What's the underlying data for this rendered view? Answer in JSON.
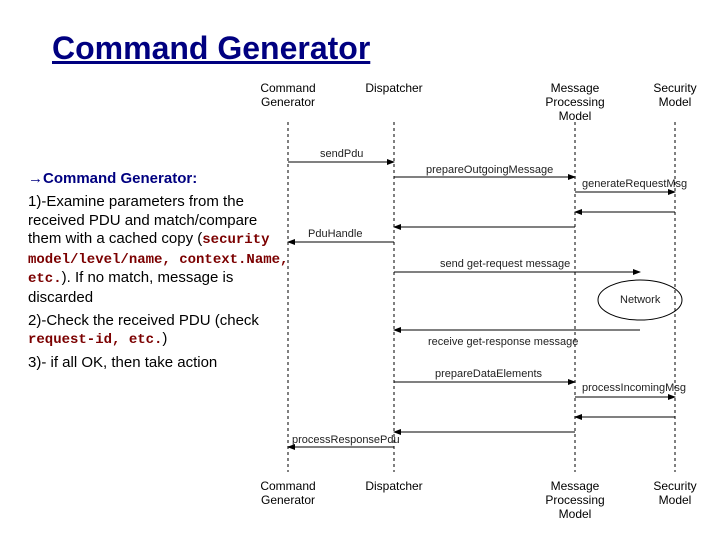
{
  "title": "Command Generator",
  "text": {
    "subheading_arrow": "→",
    "subheading": "Command Generator:",
    "item1_lead": "1)-Examine parameters from the received PDU and match/compare them with a cached copy (",
    "item1_code": "security model/level/name, context.Name, etc.",
    "item1_tail": "). If no match, message is discarded",
    "item2_lead": "2)-Check the received PDU (check ",
    "item2_code": "request-id, etc.",
    "item2_tail": ")",
    "item3": "3)- if all OK, then take action"
  },
  "diagram": {
    "headers_top": [
      "Command\nGenerator",
      "Dispatcher",
      "Message\nProcessing\nModel",
      "Security\nModel"
    ],
    "headers_bottom": [
      "Command\nGenerator",
      "Dispatcher",
      "Message\nProcessing\nModel",
      "Security\nModel"
    ],
    "labels": {
      "sendPdu": "sendPdu",
      "prepareOutgoing": "prepareOutgoingMessage",
      "generateRequest": "generateRequestMsg",
      "pduHandle": "PduHandle",
      "sendGetReq": "send get-request message",
      "network": "Network",
      "recvGetResp": "receive get-response message",
      "prepareData": "prepareDataElements",
      "processIncoming": "processIncomingMsg",
      "processResponsePdu": "processResponsePdu"
    }
  }
}
